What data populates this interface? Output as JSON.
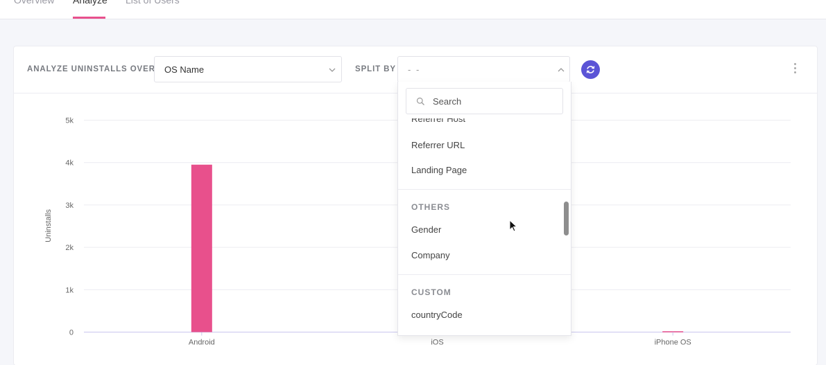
{
  "tabs": [
    {
      "label": "Overview",
      "active": false
    },
    {
      "label": "Analyze",
      "active": true
    },
    {
      "label": "List of Users",
      "active": false
    }
  ],
  "toolbar": {
    "analyze_label": "ANALYZE UNINSTALLS OVER",
    "analyze_value": "OS Name",
    "split_label": "SPLIT BY",
    "split_value": "- -",
    "refresh_icon": "refresh-icon",
    "menu_icon": "kebab-menu-icon"
  },
  "dropdown": {
    "search_placeholder": "Search",
    "partial_item": "Referrer Host",
    "items_top": [
      "Referrer URL",
      "Landing Page"
    ],
    "groups": [
      {
        "title": "OTHERS",
        "items": [
          "Gender",
          "Company"
        ]
      },
      {
        "title": "CUSTOM",
        "items": [
          "countryCode"
        ]
      }
    ]
  },
  "colors": {
    "accent": "#e8508c",
    "primary": "#5b54d6"
  },
  "chart_data": {
    "type": "bar",
    "ylabel": "Uninstalls",
    "categories": [
      "Android",
      "iOS",
      "iPhone OS"
    ],
    "values": [
      3950,
      0,
      20
    ],
    "ylim": [
      0,
      5000
    ],
    "yticks": [
      0,
      1000,
      2000,
      3000,
      4000,
      5000
    ],
    "ytick_labels": [
      "0",
      "1k",
      "2k",
      "3k",
      "4k",
      "5k"
    ],
    "grid": true,
    "bar_color": "#e8508c"
  }
}
